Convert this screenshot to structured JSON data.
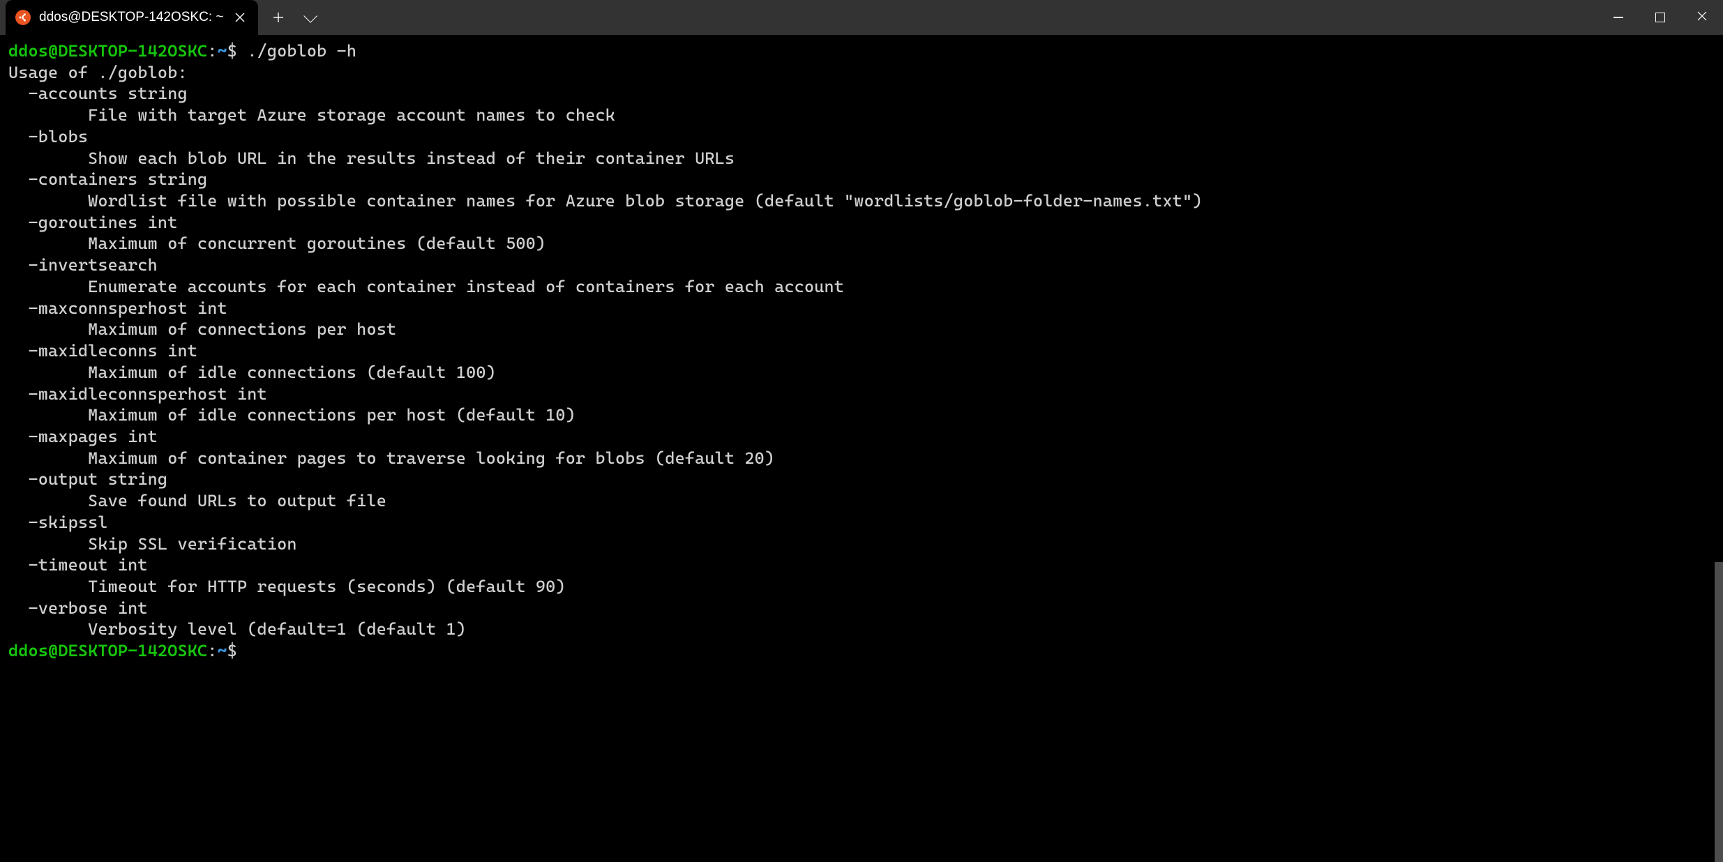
{
  "titlebar": {
    "tab": {
      "title": "ddos@DESKTOP-142OSKC: ~"
    }
  },
  "prompt": {
    "user_host": "ddos@DESKTOP-142OSKC",
    "colon": ":",
    "path": "~",
    "dollar": "$ ",
    "command": "./goblob -h",
    "partial_user_host": "ddos@DESKTOP-142OSKC",
    "partial_colon": ":",
    "partial_path": "~",
    "partial_dollar": "$"
  },
  "usage_header": "Usage of ./goblob:",
  "flags": [
    {
      "flag": "  -accounts string",
      "desc": "        File with target Azure storage account names to check"
    },
    {
      "flag": "  -blobs",
      "desc": "        Show each blob URL in the results instead of their container URLs"
    },
    {
      "flag": "  -containers string",
      "desc": "        Wordlist file with possible container names for Azure blob storage (default \"wordlists/goblob-folder-names.txt\")"
    },
    {
      "flag": "  -goroutines int",
      "desc": "        Maximum of concurrent goroutines (default 500)"
    },
    {
      "flag": "  -invertsearch",
      "desc": "        Enumerate accounts for each container instead of containers for each account"
    },
    {
      "flag": "  -maxconnsperhost int",
      "desc": "        Maximum of connections per host"
    },
    {
      "flag": "  -maxidleconns int",
      "desc": "        Maximum of idle connections (default 100)"
    },
    {
      "flag": "  -maxidleconnsperhost int",
      "desc": "        Maximum of idle connections per host (default 10)"
    },
    {
      "flag": "  -maxpages int",
      "desc": "        Maximum of container pages to traverse looking for blobs (default 20)"
    },
    {
      "flag": "  -output string",
      "desc": "        Save found URLs to output file"
    },
    {
      "flag": "  -skipssl",
      "desc": "        Skip SSL verification"
    },
    {
      "flag": "  -timeout int",
      "desc": "        Timeout for HTTP requests (seconds) (default 90)"
    },
    {
      "flag": "  -verbose int",
      "desc": "        Verbosity level (default=1 (default 1)"
    }
  ]
}
